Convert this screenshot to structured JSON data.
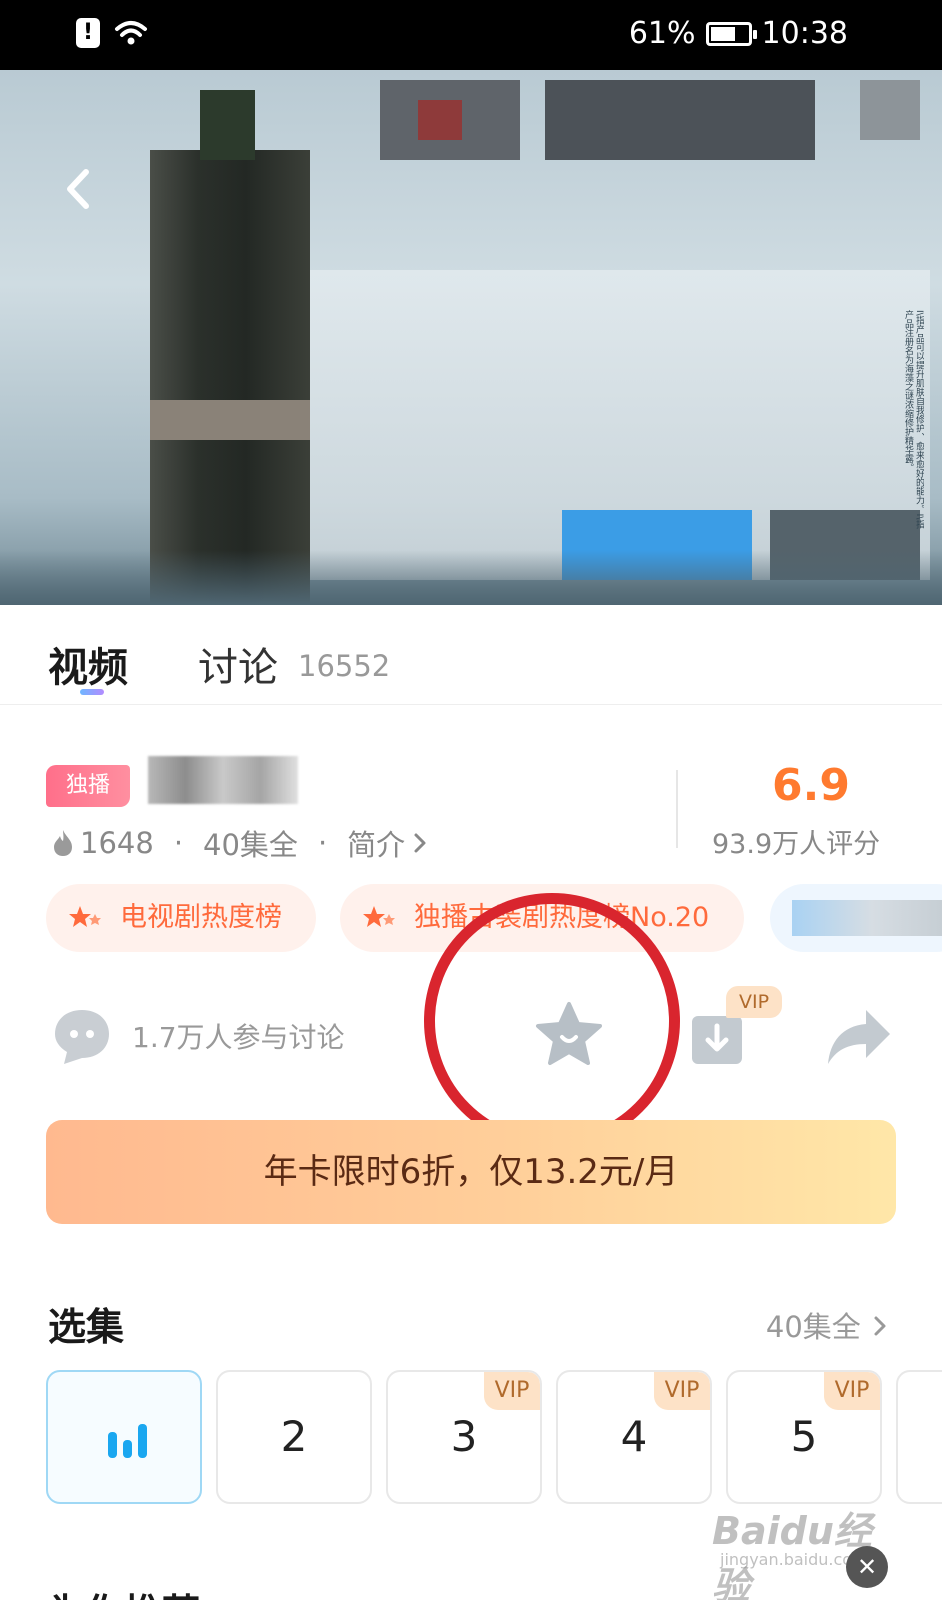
{
  "status_bar": {
    "sim_icon": "!",
    "battery_percent": "61%",
    "time": "10:38"
  },
  "video": {
    "side_text": "I\\指产品可以提升肌肤自我修护、愈来愈好的能力。I\\指产品注册名为海藻之谜浓缩修护精华露。"
  },
  "tabs": {
    "video_label": "视频",
    "discuss_label": "讨论",
    "discuss_count": "16552"
  },
  "info": {
    "exclusive_badge": "独播",
    "heat": "1648",
    "separator": "·",
    "episodes": "40集全",
    "intro_link": "简介",
    "score": "6.9",
    "rating_count": "93.9万人评分"
  },
  "rank_chips": [
    {
      "label": "电视剧热度榜"
    },
    {
      "label": "独播古装剧热度榜No.20"
    }
  ],
  "actions": {
    "discuss_text": "1.7万人参与讨论",
    "vip_badge": "VIP"
  },
  "promo": {
    "text": "年卡限时6折，仅13.2元/月"
  },
  "episodes_section": {
    "title": "选集",
    "all_link": "40集全",
    "items": [
      {
        "label": "",
        "vip": "",
        "playing": true
      },
      {
        "label": "2",
        "vip": ""
      },
      {
        "label": "3",
        "vip": "VIP"
      },
      {
        "label": "4",
        "vip": "VIP"
      },
      {
        "label": "5",
        "vip": "VIP"
      }
    ]
  },
  "next_section": {
    "title": "为你推荐"
  },
  "watermark": {
    "brand": "Baidu经验",
    "url": "jingyan.baidu.com"
  },
  "colors": {
    "accent_orange": "#ff7a2f",
    "annotation_red": "#d9252e",
    "playing_blue": "#1aa7f0"
  }
}
